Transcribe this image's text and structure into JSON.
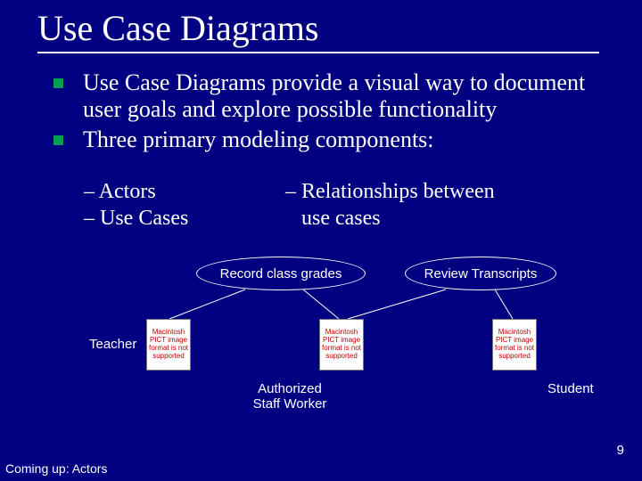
{
  "title": "Use Case Diagrams",
  "bullets": [
    "Use Case Diagrams provide a visual way to document user goals and explore possible functionality",
    "Three primary modeling components:"
  ],
  "sub_bullets": {
    "left": [
      "– Actors",
      "– Use Cases"
    ],
    "right": [
      "– Relationships between",
      "use cases"
    ]
  },
  "use_cases": {
    "record": "Record class grades",
    "review": "Review Transcripts"
  },
  "placeholder_text": "Macintosh PICT image format is not supported",
  "actors": {
    "teacher": "Teacher",
    "staff": "Authorized Staff Worker",
    "student": "Student"
  },
  "page_number": "9",
  "footer": "Coming up: Actors"
}
